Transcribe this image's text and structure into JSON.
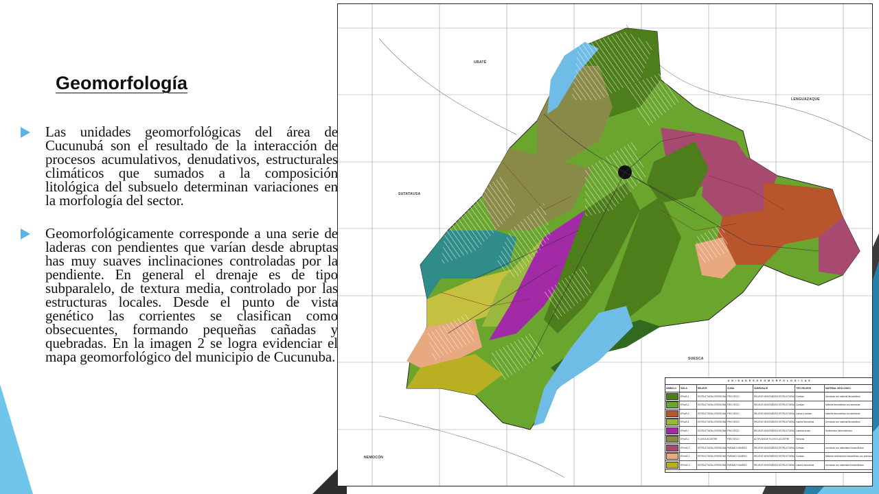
{
  "slide": {
    "title": "Geomorfología",
    "bullets": [
      "Las unidades geomorfológicas del área de Cucunubá son el resultado de la interacción de procesos acumulativos, denudativos, estructurales climáticos que sumados a la composición litológica del subsuelo determinan variaciones en la morfología del sector.",
      "Geomorfológicamente corresponde a una serie de laderas con pendientes que varían desde abruptas has muy suaves inclinaciones controladas por la pendiente. En general el drenaje es de tipo subparalelo, de textura media, controlado por las estructuras locales. Desde el punto de vista genético las corrientes se clasifican como obsecuentes, formando pequeñas cañadas y quebradas. En la imagen 2 se logra evidenciar el mapa geomorfológico del municipio de Cucunuba."
    ]
  },
  "map": {
    "place_labels": {
      "ubate": "UBATÉ",
      "lenguazaque": "LENGUAZAQUE",
      "sutatausa": "SUTATAUSA",
      "suesca": "SUESCA",
      "nemocon": "NEMOCÓN"
    },
    "legend": {
      "title": "U N I D A D E S   G E O M O R F O L O G I C A S",
      "headers": [
        "SIMBOLO",
        "SIGLA",
        "RELIEVE",
        "CLIMA",
        "SUBPAISAJE",
        "TIPO RELIEVE",
        "MATERIAL GEOLOGICO"
      ],
      "rows": [
        {
          "color": "#4e7d1c",
          "sigla": "EFsdS-1",
          "relieve": "ESTRUCTURAL EROSIONAL",
          "clima": "FRIO SECO",
          "paisaje": "RELIEVE MONTAÑOSO ESTRUCTURAL EROSIONAL",
          "tipo": "Cuestas",
          "material": "Areniscas con material limoarcilloso"
        },
        {
          "color": "#6aa62e",
          "sigla": "EFsdS-2",
          "relieve": "ESTRUCTURAL EROSIONAL",
          "clima": "FRIO SECO",
          "paisaje": "RELIEVE MONTAÑOSO ESTRUCTURAL EROSIONAL",
          "tipo": "Cuestas",
          "material": "Material limoarcilloso con areniscas"
        },
        {
          "color": "#b8552a",
          "sigla": "EFsdS-3",
          "relieve": "ESTRUCTURAL EROSIONAL",
          "clima": "FRIO SECO",
          "paisaje": "RELIEVE MONTAÑOSO ESTRUCTURAL EROSIONAL",
          "tipo": "Lomas y colinas",
          "material": "Material limoarcilloso con areniscas"
        },
        {
          "color": "#9ab83e",
          "sigla": "EFsdS-4",
          "relieve": "ESTRUCTURAL EROSIONAL",
          "clima": "FRIO SECO",
          "paisaje": "RELIEVE MONTAÑOSO ESTRUCTURAL EROSIONAL",
          "tipo": "Ladera homoclinal",
          "material": "Areniscas con material limoarcilloso"
        },
        {
          "color": "#a32aa6",
          "sigla": "EFsdS-7",
          "relieve": "ESTRUCTURAL EROSIONAL",
          "clima": "FRIO SECO",
          "paisaje": "RELIEVE MONTAÑOSO ESTRUCTURAL EROSIONAL",
          "tipo": "Laderas ácuas",
          "material": "Sedimentos heterometricos"
        },
        {
          "color": "#8a8a48",
          "sigla": "EFsdS-1",
          "relieve": "FLUVIOLACUSTRE",
          "clima": "FRIO SECO",
          "paisaje": "ALTIPLANICIE FLUVIO LACUSTRE",
          "tipo": "Terrazas",
          "material": ""
        },
        {
          "color": "#a84a70",
          "sigla": "EFmhS-1",
          "relieve": "ESTRUCTURAL EROSIONAL",
          "clima": "PARAMO HUMEDO",
          "paisaje": "RELIEVE MONTAÑOSO ESTRUCTURAL EROSIONAL",
          "tipo": "Cuestas",
          "material": "Areniscas con materiales limoarcillosos"
        },
        {
          "color": "#e8a880",
          "sigla": "EFmhS-2",
          "relieve": "ESTRUCTURAL EROSIONAL",
          "clima": "PARAMO HUMEDO",
          "paisaje": "RELIEVE MONTAÑOSO ESTRUCTURAL EROSIONAL",
          "tipo": "Cuestas",
          "material": "Material sedimentario limoarcilloso con areniscas"
        },
        {
          "color": "#b8b022",
          "sigla": "EFmhS-3",
          "relieve": "ESTRUCTURAL EROSIONAL",
          "clima": "PARAMO HUMEDO",
          "paisaje": "RELIEVE MONTAÑOSO ESTRUCTURAL EROSIONAL",
          "tipo": "Ladera homoclinal",
          "material": "Areniscas con materiales limoarcillosos"
        }
      ]
    }
  }
}
